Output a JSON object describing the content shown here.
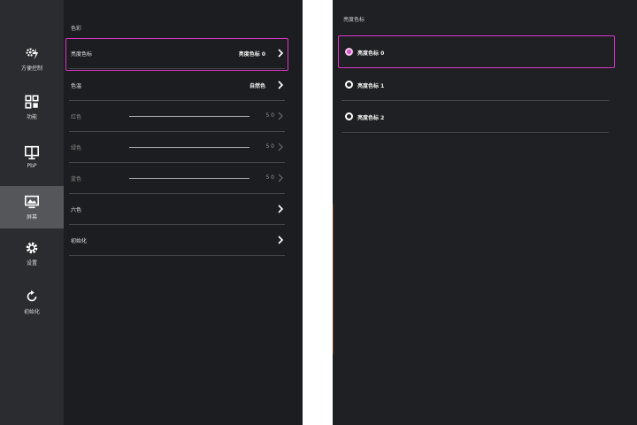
{
  "left_screen": {
    "sidebar": {
      "items": [
        {
          "label": "方便控制",
          "icon": "gear-bolt-icon",
          "active": false
        },
        {
          "label": "功能",
          "icon": "grid-icon",
          "active": false
        },
        {
          "label": "PbP",
          "icon": "pbp-icon",
          "active": false
        },
        {
          "label": "屏幕",
          "icon": "monitor-icon",
          "active": true
        },
        {
          "label": "设置",
          "icon": "gear-icon",
          "active": false
        },
        {
          "label": "初始化",
          "icon": "reset-icon",
          "active": false
        }
      ]
    },
    "section_title": "色彩",
    "rows": [
      {
        "label": "亮度色标",
        "value": "亮度色标 0",
        "focused": true
      },
      {
        "label": "色温",
        "value": "自然色"
      },
      {
        "label": "红色",
        "number": "5 0",
        "slider": true,
        "dim": true
      },
      {
        "label": "绿色",
        "number": "5 0",
        "slider": true,
        "dim": true
      },
      {
        "label": "蓝色",
        "number": "5 0",
        "slider": true,
        "dim": true
      },
      {
        "label": "六色"
      },
      {
        "label": "初始化"
      }
    ]
  },
  "right_screen": {
    "title": "亮度色标",
    "options": [
      {
        "label": "亮度色标 0",
        "selected": true
      },
      {
        "label": "亮度色标 1",
        "selected": false
      },
      {
        "label": "亮度色标 2",
        "selected": false
      }
    ]
  },
  "colors": {
    "focus_border": "#d935c4",
    "sidebar_bg": "#2b2c2f",
    "active_bg": "#55565a",
    "screen_bg": "#1c1d20"
  }
}
